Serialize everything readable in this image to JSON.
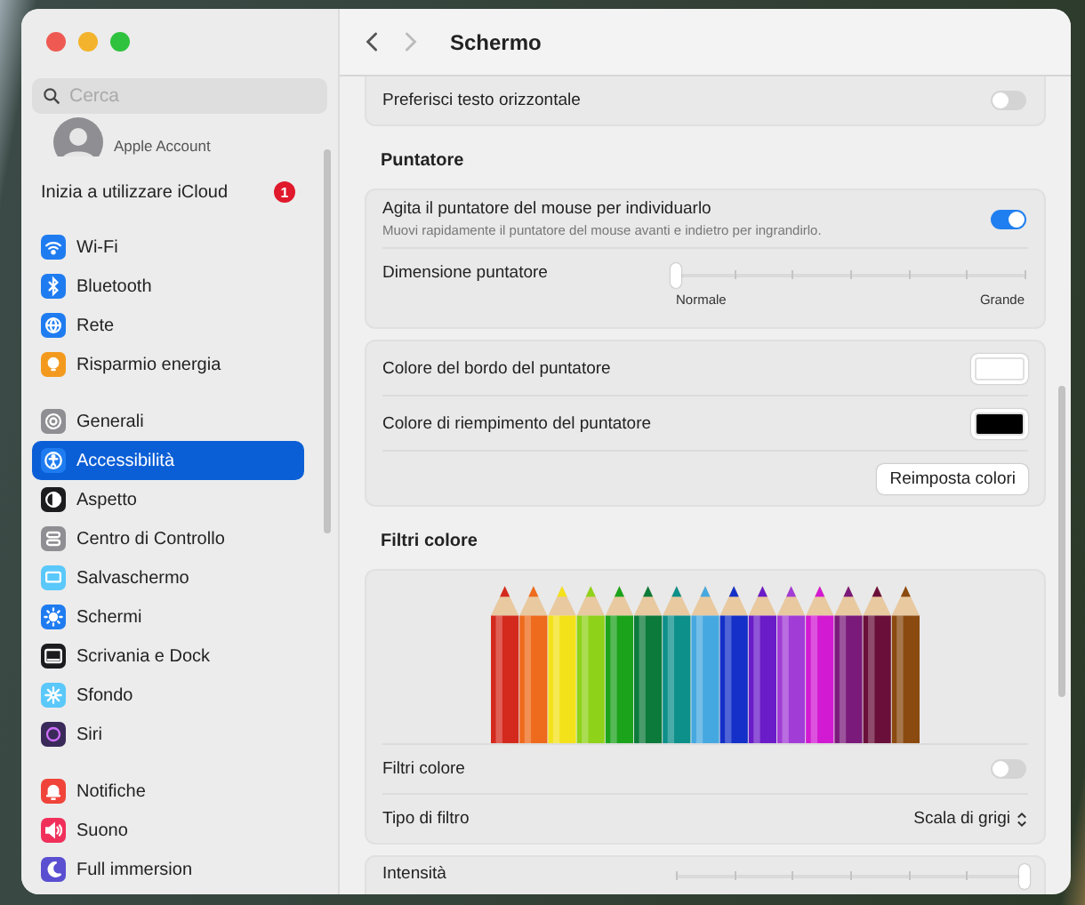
{
  "window": {
    "title": "Schermo"
  },
  "sidebar": {
    "search": {
      "placeholder": "Cerca"
    },
    "account": {
      "subtitle": "Apple Account"
    },
    "icloud": {
      "label": "Inizia a utilizzare iCloud",
      "badge": "1"
    },
    "groups": [
      {
        "items": [
          {
            "label": "Wi-Fi",
            "kind": "wifi",
            "color": "#1f7cf0",
            "selected": false
          },
          {
            "label": "Bluetooth",
            "kind": "bluetooth",
            "color": "#1f7cf0",
            "selected": false
          },
          {
            "label": "Rete",
            "kind": "globe",
            "color": "#1f7cf0",
            "selected": false
          },
          {
            "label": "Risparmio energia",
            "kind": "bulb",
            "color": "#f39a1e",
            "selected": false
          }
        ]
      },
      {
        "items": [
          {
            "label": "Generali",
            "kind": "gear",
            "color": "#8e8e93",
            "selected": false
          },
          {
            "label": "Accessibilità",
            "kind": "accessibility",
            "color": "#1f7cf0",
            "selected": true
          },
          {
            "label": "Aspetto",
            "kind": "contrast",
            "color": "#1c1c1e",
            "selected": false
          },
          {
            "label": "Centro di Controllo",
            "kind": "toggles",
            "color": "#8e8e93",
            "selected": false
          },
          {
            "label": "Salvaschermo",
            "kind": "screen",
            "color": "#5ac8fa",
            "selected": false
          },
          {
            "label": "Schermi",
            "kind": "sun",
            "color": "#1f7cf0",
            "selected": false
          },
          {
            "label": "Scrivania e Dock",
            "kind": "dock",
            "color": "#1c1c1e",
            "selected": false
          },
          {
            "label": "Sfondo",
            "kind": "flower",
            "color": "#5ac8fa",
            "selected": false
          },
          {
            "label": "Siri",
            "kind": "orb",
            "color": "#3a2a5a",
            "selected": false
          }
        ]
      },
      {
        "items": [
          {
            "label": "Notifiche",
            "kind": "bell",
            "color": "#f0443a",
            "selected": false
          },
          {
            "label": "Suono",
            "kind": "speaker",
            "color": "#f0305a",
            "selected": false
          },
          {
            "label": "Full immersion",
            "kind": "moon",
            "color": "#5a4fd0",
            "selected": false
          }
        ]
      }
    ]
  },
  "content": {
    "sections": [
      {
        "panels": [
          {
            "rows": [
              {
                "kind": "toggle",
                "label": "Preferisci testo orizzontale",
                "on": false
              }
            ]
          }
        ]
      },
      {
        "heading": "Puntatore",
        "panels": [
          {
            "rows": [
              {
                "kind": "toggle",
                "label": "Agita il puntatore del mouse per individuarlo",
                "description": "Muovi rapidamente il puntatore del mouse avanti e indietro per ingrandirlo.",
                "on": true
              },
              {
                "kind": "slider",
                "label": "Dimensione puntatore",
                "level": 0,
                "min_label": "Normale",
                "max_label": "Grande"
              }
            ]
          },
          {
            "rows": [
              {
                "kind": "color",
                "label": "Colore del bordo del puntatore",
                "color": "#ffffff"
              },
              {
                "kind": "color",
                "label": "Colore di riempimento del puntatore",
                "color": "#000000"
              },
              {
                "kind": "button",
                "label": "Reimposta colori"
              }
            ]
          }
        ]
      },
      {
        "heading": "Filtri colore",
        "panels": [
          {
            "rows": [
              {
                "kind": "image"
              },
              {
                "kind": "toggle",
                "label": "Filtri colore",
                "on": false
              },
              {
                "kind": "popup",
                "label": "Tipo di filtro",
                "value": "Scala di grigi"
              }
            ]
          },
          {
            "rows": [
              {
                "kind": "slider",
                "label": "Intensità",
                "level": 1
              }
            ]
          }
        ]
      }
    ]
  }
}
